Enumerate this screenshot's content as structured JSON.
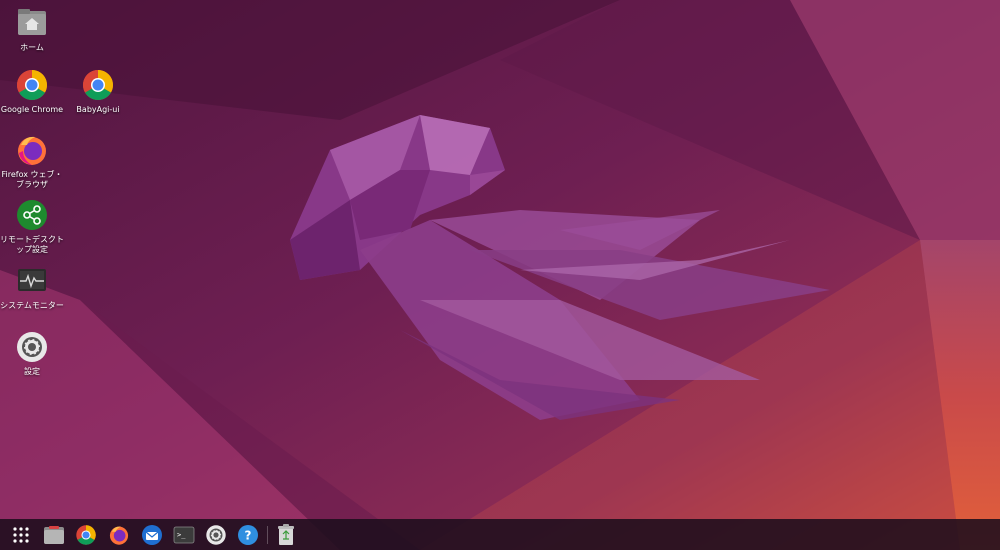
{
  "desktop": {
    "icons": [
      {
        "label": "ホーム",
        "icon": "home-folder-icon"
      },
      {
        "label": "Google Chrome",
        "icon": "chrome-icon"
      },
      {
        "label": "BabyAgi-ui",
        "icon": "chrome-icon"
      },
      {
        "label": "Firefox ウェブ・ブラウザ",
        "icon": "firefox-icon"
      },
      {
        "label": "リモートデスクトップ設定",
        "icon": "share-icon"
      },
      {
        "label": "システムモニター",
        "icon": "system-monitor-icon"
      },
      {
        "label": "設定",
        "icon": "settings-gear-icon"
      }
    ]
  },
  "taskbar": {
    "items": [
      {
        "icon": "app-grid-icon"
      },
      {
        "icon": "files-icon"
      },
      {
        "icon": "chrome-icon"
      },
      {
        "icon": "firefox-icon"
      },
      {
        "icon": "thunderbird-icon"
      },
      {
        "icon": "terminal-icon"
      },
      {
        "icon": "settings-icon"
      },
      {
        "icon": "help-icon"
      },
      {
        "icon": "trash-icon"
      }
    ]
  },
  "colors": {
    "wallpaper_dark": "#4a1438",
    "wallpaper_mid": "#7a2257",
    "wallpaper_orange": "#d9543a",
    "jellyfish": "#9b4a9b",
    "taskbar": "#1c0e1c"
  }
}
